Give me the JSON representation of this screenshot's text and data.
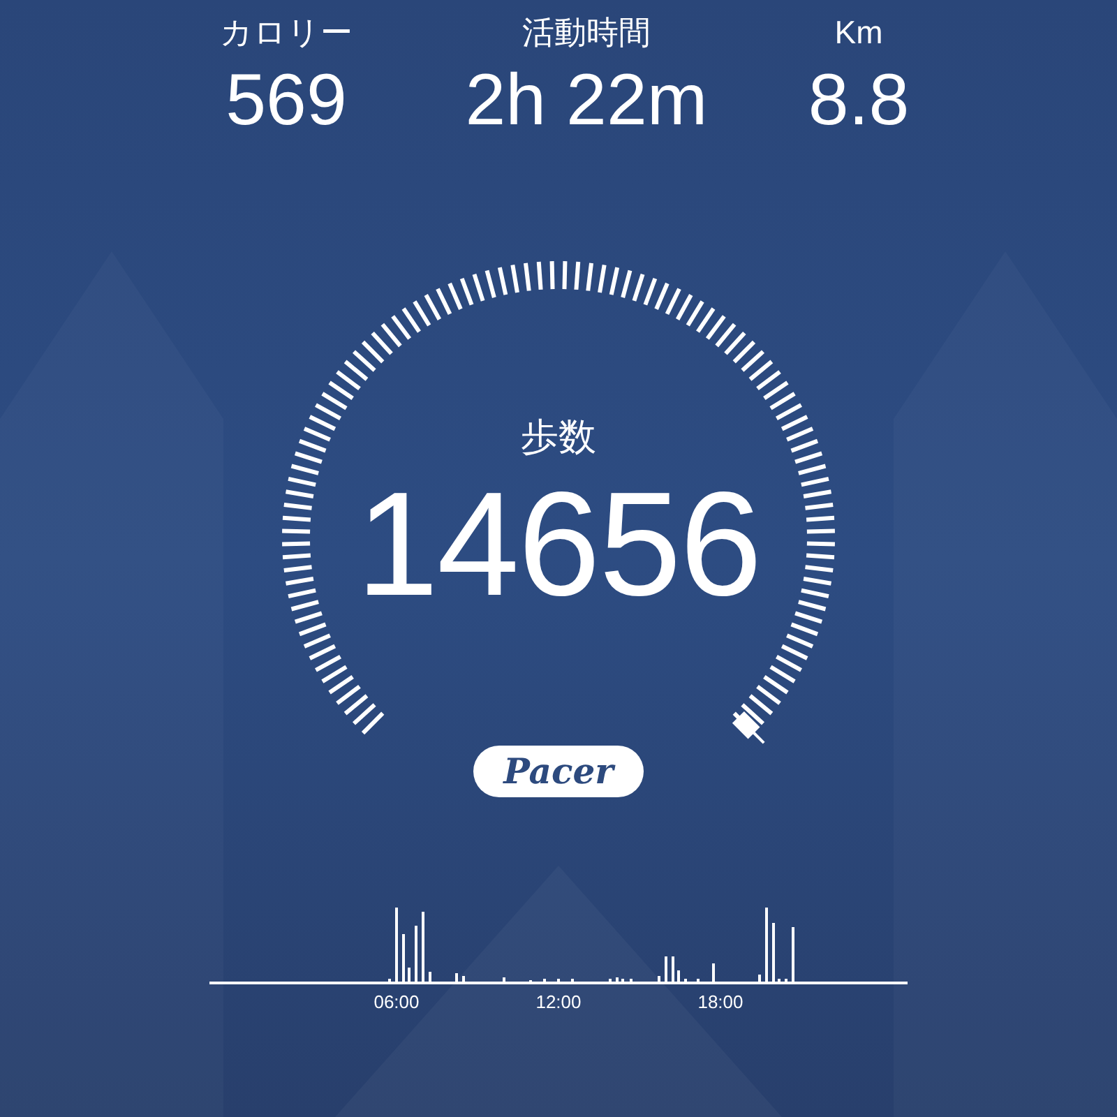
{
  "stats": [
    {
      "label": "カロリー",
      "value": "569"
    },
    {
      "label": "活動時間",
      "value": "2h 22m"
    },
    {
      "label": "Km",
      "value": "8.8"
    }
  ],
  "gauge": {
    "label": "歩数",
    "value": "14656"
  },
  "logo": "Pacer",
  "activity": {
    "time_labels": [
      "06:00",
      "12:00",
      "18:00"
    ]
  }
}
